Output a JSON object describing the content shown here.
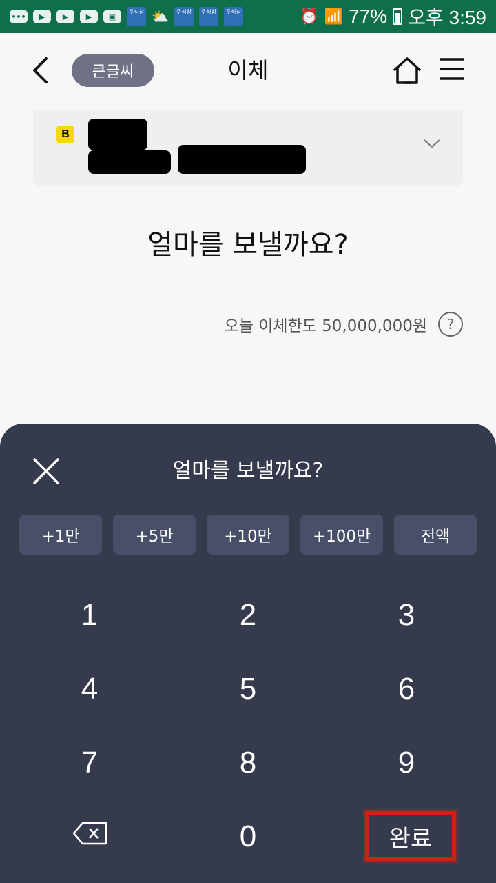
{
  "status_bar": {
    "app_icon_label": "주식창",
    "battery": "77%",
    "time": "오후 3:59"
  },
  "header": {
    "big_font_label": "큰글씨",
    "title": "이체"
  },
  "account": {
    "bank_logo": "B"
  },
  "main": {
    "question": "얼마를 보낼까요?",
    "limit_text": "오늘 이체한도 50,000,000원",
    "help_symbol": "?"
  },
  "keypad": {
    "title": "얼마를 보낼까요?",
    "quick_amounts": [
      "+1만",
      "+5만",
      "+10만",
      "+100만",
      "전액"
    ],
    "keys": [
      "1",
      "2",
      "3",
      "4",
      "5",
      "6",
      "7",
      "8",
      "9",
      "0"
    ],
    "done_label": "완료"
  },
  "colors": {
    "status_bar": "#0f6f4a",
    "keypad_bg": "#363a4d",
    "quick_button_bg": "#4a4f69",
    "highlight": "#cc2211",
    "bank_logo": "#f5d90a"
  }
}
